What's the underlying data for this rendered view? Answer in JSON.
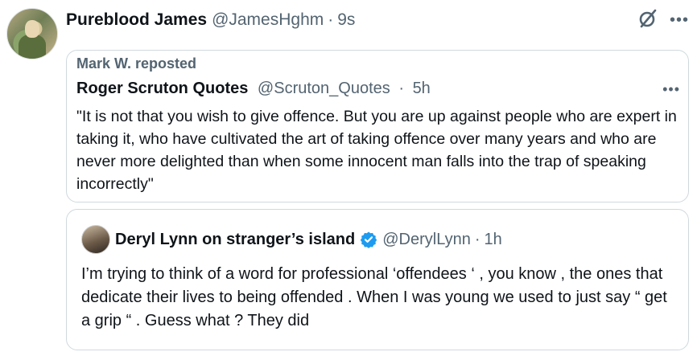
{
  "post": {
    "author_name": "Pureblood James",
    "author_handle": "@JamesHghm",
    "separator": "·",
    "time": "9s"
  },
  "quoted_repost": {
    "repost_label": "Mark W. reposted",
    "author_name": "Roger Scruton Quotes",
    "author_handle": "@Scruton_Quotes",
    "separator": "·",
    "time": "5h",
    "text": "\"It is not that you wish to give offence. But you are up against people who are expert in taking it, who have cultivated the art of taking offence over many years and who are never more delighted than when some innocent man falls into the trap of speaking incorrectly\""
  },
  "quoted_tweet": {
    "author_name": "Deryl Lynn on stranger’s island",
    "author_handle": "@DerylLynn",
    "separator": "·",
    "time": "1h",
    "verified": true,
    "text": "I’m trying to think of a word for professional  ‘offendees ‘ , you know , the ones that dedicate their lives to being offended . When I was young we used to just say “ get a grip “ . Guess what ? They did"
  },
  "icons": {
    "grok": "grok-icon",
    "more": "more-icon",
    "verified": "verified-badge-icon"
  },
  "colors": {
    "text": "#0f1419",
    "secondary": "#536471",
    "border": "#cfd9de",
    "verified": "#1d9bf0"
  }
}
